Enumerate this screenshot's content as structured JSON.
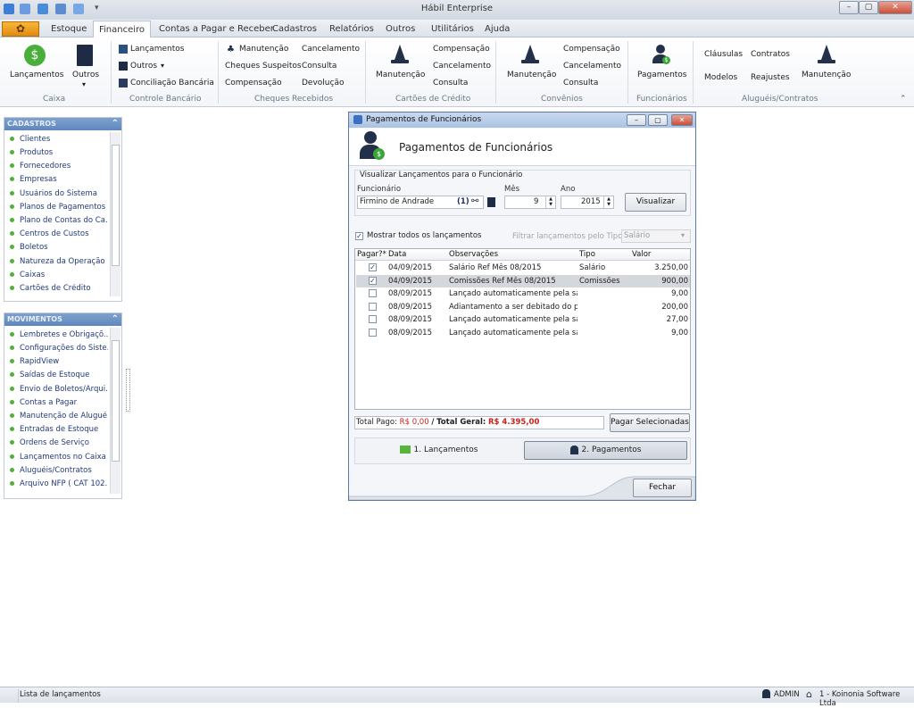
{
  "app": {
    "title": "Hábil Enterprise",
    "window_buttons": [
      "–",
      "▢",
      "✕"
    ]
  },
  "menu": {
    "items": [
      "Estoque",
      "Financeiro",
      "Contas a Pagar e Receber",
      "Cadastros",
      "Relatórios",
      "Outros",
      "Utilitários",
      "Ajuda"
    ],
    "active": "Financeiro"
  },
  "ribbon": {
    "caixa": {
      "lancamentos": "Lançamentos",
      "outros": "Outros",
      "group": "Caixa"
    },
    "controle": {
      "lancamentos": "Lançamentos",
      "outros": "Outros",
      "conciliacao": "Conciliação Bancária",
      "group": "Controle Bancário"
    },
    "cheques": {
      "manutencao": "Manutenção",
      "suspeitos": "Cheques Suspeitos",
      "compensacao": "Compensação",
      "cancelamento": "Cancelamento",
      "consulta": "Consulta",
      "devolucao": "Devolução",
      "group": "Cheques Recebidos"
    },
    "cartoes": {
      "manutencao": "Manutenção",
      "compensacao": "Compensação",
      "cancelamento": "Cancelamento",
      "consulta": "Consulta",
      "group": "Cartões de Crédito"
    },
    "convenios": {
      "manutencao": "Manutenção",
      "compensacao": "Compensação",
      "cancelamento": "Cancelamento",
      "consulta": "Consulta",
      "group": "Convênios"
    },
    "funcionarios": {
      "pagamentos": "Pagamentos",
      "group": "Funcionários"
    },
    "alugueis": {
      "clausulas": "Cláusulas",
      "modelos": "Modelos",
      "contratos": "Contratos",
      "reajustes": "Reajustes",
      "manutencao": "Manutenção",
      "group": "Aluguéis/Contratos"
    }
  },
  "cadastros": {
    "title": "CADASTROS",
    "items": [
      "Clientes",
      "Produtos",
      "Fornecedores",
      "Empresas",
      "Usuários do Sistema",
      "Planos de Pagamentos",
      "Plano de Contas do Ca...",
      "Centros de Custos",
      "Boletos",
      "Natureza da Operação",
      "Caixas",
      "Cartões de Crédito"
    ]
  },
  "movimentos": {
    "title": "MOVIMENTOS",
    "items": [
      "Lembretes e Obrigaçõ...",
      "Configurações do Siste...",
      "RapidView",
      "Saídas de Estoque",
      "Envio de Boletos/Arqui...",
      "Contas a Pagar",
      "Manutenção de Alugué...",
      "Entradas de Estoque",
      "Ordens de Serviço",
      "Lançamentos no Caixa",
      "Aluguéis/Contratos",
      "Arquivo NFP ( CAT 102..."
    ]
  },
  "dialog": {
    "title": "Pagamentos de Funcionários",
    "header": "Pagamentos de Funcionários",
    "section": "Visualizar Lançamentos para o Funcionário",
    "funcionario_label": "Funcionário",
    "funcionario_value": "Firmino de Andrade",
    "funcionario_code": "(1)",
    "mes_label": "Mês",
    "mes_value": "9",
    "ano_label": "Ano",
    "ano_value": "2015",
    "visualizar": "Visualizar",
    "mostrar_todos": "Mostrar todos os lançamentos",
    "filtrar_label": "Filtrar lançamentos pelo Tipo :",
    "filtrar_value": "Salário",
    "columns": [
      "Pagar?*",
      "Data",
      "Observações",
      "Tipo",
      "Valor"
    ],
    "rows": [
      {
        "checked": true,
        "data": "04/09/2015",
        "obs": "Salário Ref Mês 08/2015",
        "tipo": "Salário",
        "valor": "3.250,00"
      },
      {
        "checked": true,
        "data": "04/09/2015",
        "obs": "Comissões Ref Mês 08/2015",
        "tipo": "Comissões",
        "valor": "900,00"
      },
      {
        "checked": false,
        "data": "08/09/2015",
        "obs": "Lançado automaticamente pela saí...",
        "tipo": "",
        "valor": "9,00"
      },
      {
        "checked": false,
        "data": "08/09/2015",
        "obs": "Adiantamento a ser debitado do p...",
        "tipo": "",
        "valor": "200,00"
      },
      {
        "checked": false,
        "data": "08/09/2015",
        "obs": "Lançado automaticamente pela saí...",
        "tipo": "",
        "valor": "27,00"
      },
      {
        "checked": false,
        "data": "08/09/2015",
        "obs": "Lançado automaticamente pela saí...",
        "tipo": "",
        "valor": "9,00"
      }
    ],
    "total_pago_label": "Total Pago:",
    "total_pago_value": "R$ 0,00",
    "slash": "/",
    "total_geral_label": "Total Geral:",
    "total_geral_value": "R$ 4.395,00",
    "pagar_selecionadas": "Pagar Selecionadas",
    "tab1": "1. Lançamentos",
    "tab2": "2. Pagamentos",
    "fechar": "Fechar"
  },
  "status": {
    "text": "Lista de lançamentos",
    "user": "ADMIN",
    "company": "1 - Koinonia Software Ltda"
  },
  "colors": {
    "accent": "#5f87bd",
    "total_red": "#d0201a",
    "dollar_green": "#3aa63a"
  }
}
